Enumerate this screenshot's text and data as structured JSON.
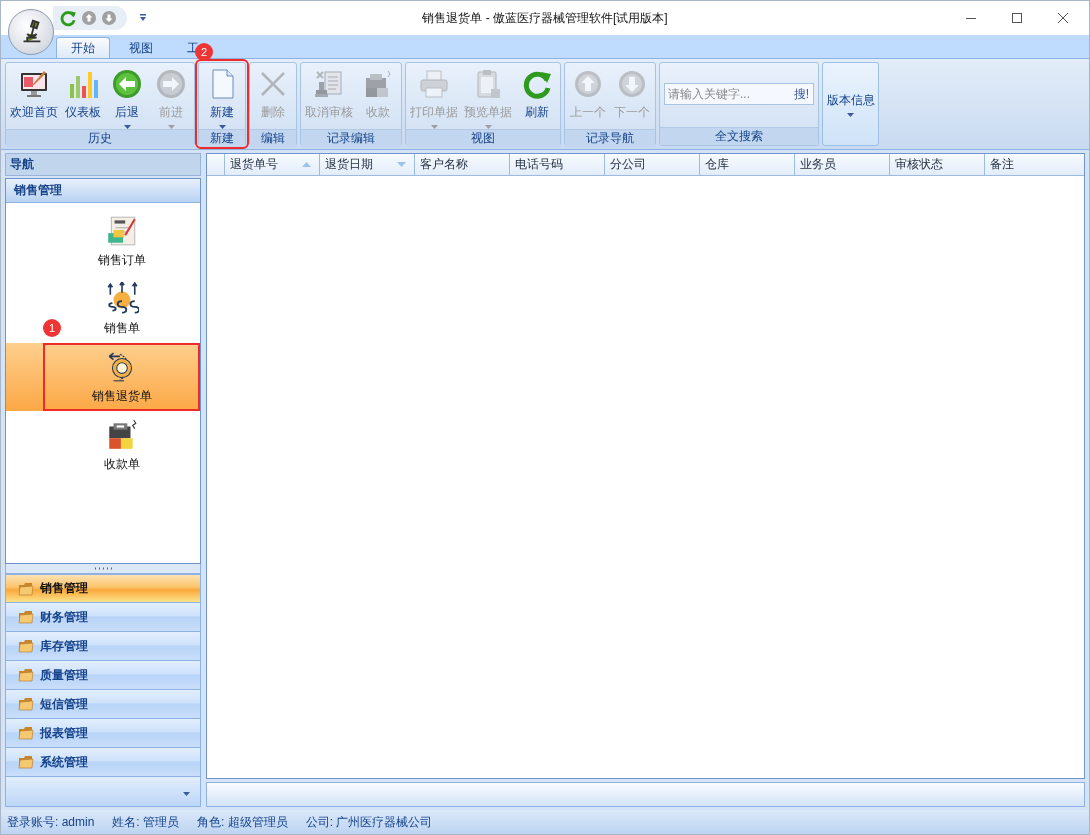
{
  "window": {
    "title": "销售退货单 - 傲蓝医疗器械管理软件[试用版本]"
  },
  "ribbon": {
    "tabs": [
      {
        "label": "开始",
        "selected": true
      },
      {
        "label": "视图",
        "selected": false
      },
      {
        "label": "工",
        "selected": false
      }
    ],
    "groups": [
      {
        "kind": "buttons",
        "caption": "历史",
        "highlighted": false,
        "buttons": [
          {
            "label": "欢迎首页",
            "disabled": false,
            "dropdown": false
          },
          {
            "label": "仪表板",
            "disabled": false,
            "dropdown": false
          },
          {
            "label": "后退",
            "disabled": false,
            "dropdown": true
          },
          {
            "label": "前进",
            "disabled": true,
            "dropdown": true
          }
        ]
      },
      {
        "kind": "buttons",
        "caption": "新建",
        "highlighted": true,
        "annotation": "2",
        "buttons": [
          {
            "label": "新建",
            "disabled": false,
            "dropdown": true
          }
        ]
      },
      {
        "kind": "buttons",
        "caption": "编辑",
        "highlighted": false,
        "buttons": [
          {
            "label": "删除",
            "disabled": true,
            "dropdown": false
          }
        ]
      },
      {
        "kind": "buttons",
        "caption": "记录编辑",
        "highlighted": false,
        "buttons": [
          {
            "label": "取消审核",
            "disabled": true,
            "dropdown": false
          },
          {
            "label": "收款",
            "disabled": true,
            "dropdown": false
          }
        ]
      },
      {
        "kind": "buttons",
        "caption": "视图",
        "highlighted": false,
        "buttons": [
          {
            "label": "打印单据",
            "disabled": true,
            "dropdown": true
          },
          {
            "label": "预览单据",
            "disabled": true,
            "dropdown": true
          },
          {
            "label": "刷新",
            "disabled": false,
            "dropdown": false
          }
        ]
      },
      {
        "kind": "buttons",
        "caption": "记录导航",
        "highlighted": false,
        "buttons": [
          {
            "label": "上一个",
            "disabled": true,
            "dropdown": false
          },
          {
            "label": "下一个",
            "disabled": true,
            "dropdown": false
          }
        ]
      },
      {
        "kind": "search",
        "caption": "全文搜索",
        "placeholder": "请输入关键字...",
        "button": "搜!"
      },
      {
        "kind": "large",
        "label": "版本信息",
        "dropdown": true
      }
    ]
  },
  "navigation": {
    "title": "导航",
    "section": "销售管理",
    "items": [
      {
        "label": "销售订单",
        "selected": false
      },
      {
        "label": "销售单",
        "selected": false
      },
      {
        "label": "销售退货单",
        "selected": true,
        "annotation": "1"
      },
      {
        "label": "收款单",
        "selected": false
      }
    ],
    "groups": [
      {
        "label": "销售管理",
        "selected": true
      },
      {
        "label": "财务管理",
        "selected": false
      },
      {
        "label": "库存管理",
        "selected": false
      },
      {
        "label": "质量管理",
        "selected": false
      },
      {
        "label": "短信管理",
        "selected": false
      },
      {
        "label": "报表管理",
        "selected": false
      },
      {
        "label": "系统管理",
        "selected": false
      }
    ]
  },
  "table": {
    "columns": [
      {
        "label": "退货单号",
        "sorted_ascending": true,
        "sorted_descending": false
      },
      {
        "label": "退货日期",
        "sorted_ascending": false,
        "sorted_descending": true
      },
      {
        "label": "客户名称",
        "sorted_ascending": false,
        "sorted_descending": false
      },
      {
        "label": "电话号码",
        "sorted_ascending": false,
        "sorted_descending": false
      },
      {
        "label": "分公司",
        "sorted_ascending": false,
        "sorted_descending": false
      },
      {
        "label": "仓库",
        "sorted_ascending": false,
        "sorted_descending": false
      },
      {
        "label": "业务员",
        "sorted_ascending": false,
        "sorted_descending": false
      },
      {
        "label": "审核状态",
        "sorted_ascending": false,
        "sorted_descending": false
      },
      {
        "label": "备注",
        "sorted_ascending": false,
        "sorted_descending": false
      }
    ]
  },
  "status_bar": [
    "登录账号: admin",
    "姓名: 管理员",
    "角色: 超级管理员",
    "公司: 广州医疗器械公司"
  ]
}
